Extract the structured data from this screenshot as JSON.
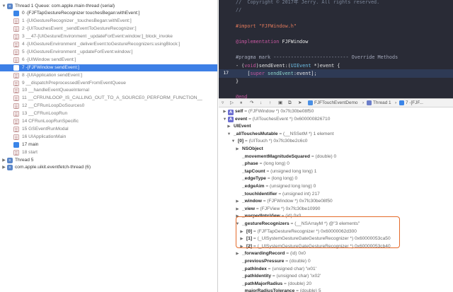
{
  "navigator": {
    "rows": [
      {
        "kind": "thread",
        "tri": "▼",
        "text": "Thread 1 Queue: com.apple.main-thread (serial)"
      },
      {
        "kind": "app",
        "text": "0 -[FJFTapGestureRecognizer touchesBegan:withEvent:]"
      },
      {
        "kind": "sys",
        "text": "1 -[UIGestureRecognizer _touchesBegan:withEvent:]"
      },
      {
        "kind": "sys",
        "text": "2 -[UITouchesEvent _sendEventToGestureRecognizer:]"
      },
      {
        "kind": "sys",
        "text": "3 __47-[UIGestureEnvironment _updateForEvent:window:]_block_invoke"
      },
      {
        "kind": "sys",
        "text": "4 -[UIGestureEnvironment _deliverEvent:toGestureRecognizers:usingBlock:]"
      },
      {
        "kind": "sys",
        "text": "5 -[UIGestureEnvironment _updateForEvent:window:]"
      },
      {
        "kind": "sys",
        "text": "6 -[UIWindow sendEvent:]"
      },
      {
        "kind": "app",
        "text": "7 -[FJFWindow sendEvent:]",
        "selected": true
      },
      {
        "kind": "sys",
        "text": "8 -[UIApplication sendEvent:]"
      },
      {
        "kind": "sys",
        "text": "9 __dispatchPreprocessedEventFromEventQueue"
      },
      {
        "kind": "sys",
        "text": "10 __handleEventQueueInternal"
      },
      {
        "kind": "sys",
        "text": "11 __CFRUNLOOP_IS_CALLING_OUT_TO_A_SOURCE0_PERFORM_FUNCTION__"
      },
      {
        "kind": "sys",
        "text": "12 __CFRunLoopDoSources0"
      },
      {
        "kind": "sys",
        "text": "13 __CFRunLoopRun"
      },
      {
        "kind": "sys",
        "text": "14 CFRunLoopRunSpecific"
      },
      {
        "kind": "sys",
        "text": "15 GSEventRunModal"
      },
      {
        "kind": "sys",
        "text": "16 UIApplicationMain"
      },
      {
        "kind": "app",
        "text": "17 main"
      },
      {
        "kind": "sys",
        "text": "18 start"
      },
      {
        "kind": "thread",
        "tri": "▶",
        "text": "Thread 5"
      },
      {
        "kind": "thread",
        "tri": "▶",
        "text": "com.apple.uikit.eventfetch-thread (6)"
      }
    ]
  },
  "editor": {
    "lines": [
      {
        "num": "",
        "tokens": [
          {
            "c": "c-cm",
            "t": "//  Copyright © 2017年 Jerry. All rights reserved."
          }
        ]
      },
      {
        "num": "",
        "tokens": [
          {
            "c": "c-cm",
            "t": "//"
          }
        ]
      },
      {
        "num": "",
        "tokens": [
          {
            "c": "c-pl",
            "t": ""
          }
        ]
      },
      {
        "num": "",
        "tokens": [
          {
            "c": "c-pp",
            "t": "#import "
          },
          {
            "c": "c-str",
            "t": "\"FJFWindow.h\""
          }
        ]
      },
      {
        "num": "",
        "tokens": [
          {
            "c": "c-pl",
            "t": ""
          }
        ]
      },
      {
        "num": "",
        "tokens": [
          {
            "c": "c-kw",
            "t": "@implementation"
          },
          {
            "c": "c-pl",
            "t": " FJFWindow"
          }
        ]
      },
      {
        "num": "",
        "tokens": [
          {
            "c": "c-pl",
            "t": ""
          }
        ]
      },
      {
        "num": "",
        "tokens": [
          {
            "c": "c-mark",
            "t": "#pragma mark -------------------------- Override Methods"
          }
        ]
      },
      {
        "num": "",
        "tokens": [
          {
            "c": "c-pl",
            "t": "- ("
          },
          {
            "c": "c-kw",
            "t": "void"
          },
          {
            "c": "c-pl",
            "t": ")sendEvent:("
          },
          {
            "c": "c-cls",
            "t": "UIEvent"
          },
          {
            "c": "c-pl",
            "t": " *)event {"
          }
        ]
      },
      {
        "num": "17",
        "hl": true,
        "tokens": [
          {
            "c": "c-pl",
            "t": "    ["
          },
          {
            "c": "c-kw",
            "t": "super"
          },
          {
            "c": "c-pl",
            "t": " "
          },
          {
            "c": "c-meth",
            "t": "sendEvent"
          },
          {
            "c": "c-pl",
            "t": ":event];"
          }
        ]
      },
      {
        "num": "",
        "tokens": [
          {
            "c": "c-pl",
            "t": "}"
          }
        ]
      },
      {
        "num": "",
        "tokens": [
          {
            "c": "c-pl",
            "t": ""
          }
        ]
      },
      {
        "num": "",
        "tokens": [
          {
            "c": "c-kw",
            "t": "@end"
          }
        ]
      }
    ]
  },
  "debugbar": {
    "project": "FJFTouchEventDemo",
    "thread": "Thread 1",
    "frame": "7 -[FJF..."
  },
  "variables": {
    "rows": [
      {
        "indent": 0,
        "tri": "▶",
        "badge": "A",
        "name": "self",
        "val": "= (FJFWindow *) 0x7fc30be08f50"
      },
      {
        "indent": 0,
        "tri": "▼",
        "badge": "A",
        "name": "event",
        "val": "= (UITouchesEvent *) 0x600000826710"
      },
      {
        "indent": 1,
        "tri": "▶",
        "name": "UIEvent",
        "val": ""
      },
      {
        "indent": 1,
        "tri": "▼",
        "name": "_allTouchesMutable",
        "val": "= (__NSSetM *) 1 element"
      },
      {
        "indent": 2,
        "tri": "▼",
        "name": "[0]",
        "val": "= (UITouch *) 0x7fc30be2c6c0"
      },
      {
        "indent": 3,
        "tri": "▶",
        "name": "NSObject",
        "val": ""
      },
      {
        "indent": 3,
        "name": "_movementMagnitudeSquared",
        "val": "= (double) 0"
      },
      {
        "indent": 3,
        "name": "_phase",
        "val": "= (long long) 0"
      },
      {
        "indent": 3,
        "name": "_tapCount",
        "val": "= (unsigned long long) 1"
      },
      {
        "indent": 3,
        "name": "_edgeType",
        "val": "= (long long) 0"
      },
      {
        "indent": 3,
        "name": "_edgeAim",
        "val": "= (unsigned long long) 0"
      },
      {
        "indent": 3,
        "name": "_touchIdentifier",
        "val": "= (unsigned int) 217"
      },
      {
        "indent": 3,
        "tri": "▶",
        "name": "_window",
        "val": "= (FJFWindow *) 0x7fc30be08f50"
      },
      {
        "indent": 3,
        "tri": "▶",
        "name": "_view",
        "val": "= (FJFView *) 0x7fc30be10990"
      },
      {
        "indent": 3,
        "tri": "▶",
        "name": "_warpedIntoView",
        "val": "= (id) 0x0"
      },
      {
        "indent": 3,
        "tri": "▼",
        "name": "_gestureRecognizers",
        "val": "= (__NSArrayM *) @\"3 elements\""
      },
      {
        "indent": 4,
        "tri": "▶",
        "name": "[0]",
        "val": "= (FJFTapGestureRecognizer *) 0x60000062d300"
      },
      {
        "indent": 4,
        "tri": "▶",
        "name": "[1]",
        "val": "= (_UISystemGestureGateGestureRecognizer *) 0x60000053ca50"
      },
      {
        "indent": 4,
        "tri": "▶",
        "name": "[2]",
        "val": "= (_UISystemGestureGateGestureRecognizer *) 0x60000053cb40"
      },
      {
        "indent": 3,
        "tri": "▶",
        "name": "_forwardingRecord",
        "val": "= (id) 0x0"
      },
      {
        "indent": 3,
        "name": "_previousPressure",
        "val": "= (double) 0"
      },
      {
        "indent": 3,
        "name": "_pathIndex",
        "val": "= (unsigned char) '\\x01'"
      },
      {
        "indent": 3,
        "name": "_pathIdentity",
        "val": "= (unsigned char) '\\x02'"
      },
      {
        "indent": 3,
        "name": "_pathMajorRadius",
        "val": "= (double) 20"
      },
      {
        "indent": 3,
        "name": "_majorRadiusTolerance",
        "val": "= (double) 5"
      }
    ]
  },
  "colors": {
    "selection": "#3d7fe6",
    "editor_bg": "#292b36",
    "highlight_box": "#e46b2a"
  }
}
